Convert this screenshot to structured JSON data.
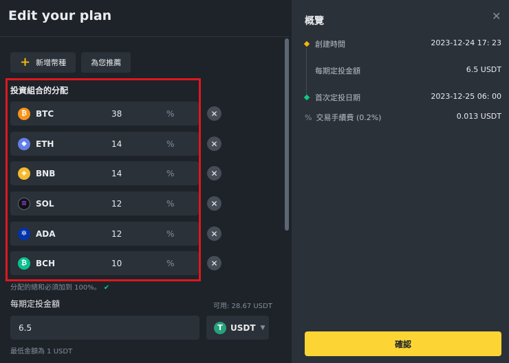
{
  "dialog": {
    "title": "Edit your plan"
  },
  "actions": {
    "add_coin_label": "新增幣種",
    "recommend_label": "為您推薦"
  },
  "allocation": {
    "label": "投資組合的分配",
    "percent_symbol": "%",
    "remove_symbol": "✕",
    "coins": [
      {
        "symbol": "BTC",
        "value": "38",
        "icon": "btc-icon",
        "color": "#f7931a",
        "glyph": "₿"
      },
      {
        "symbol": "ETH",
        "value": "14",
        "icon": "eth-icon",
        "color": "#627eea",
        "glyph": "◆"
      },
      {
        "symbol": "BNB",
        "value": "14",
        "icon": "bnb-icon",
        "color": "#f3ba2f",
        "glyph": "◈"
      },
      {
        "symbol": "SOL",
        "value": "12",
        "icon": "sol-icon",
        "color": "#111111",
        "glyph": "≡"
      },
      {
        "symbol": "ADA",
        "value": "12",
        "icon": "ada-icon",
        "color": "#0033ad",
        "glyph": "✲"
      },
      {
        "symbol": "BCH",
        "value": "10",
        "icon": "bch-icon",
        "color": "#0ac18e",
        "glyph": "₿"
      }
    ],
    "note": "分配的總和必須加到 100%。",
    "note_check": "✔"
  },
  "periodic": {
    "label": "每期定投金額",
    "available": "可用: 28.67 USDT",
    "amount": "6.5",
    "currency": "USDT",
    "currency_icon": "usdt-icon",
    "currency_glyph": "T",
    "caret": "▼",
    "min_note": "最低金額為 1 USDT"
  },
  "summary": {
    "title": "概覽",
    "close": "✕",
    "rows": [
      {
        "label": "創建時間",
        "value": "2023-12-24 17: 23"
      },
      {
        "label": "每期定投金額",
        "value": "6.5 USDT"
      },
      {
        "label": "首次定投日期",
        "value": "2023-12-25 06: 00"
      },
      {
        "label": "交易手續費 (0.2%)",
        "value": "0.013 USDT"
      }
    ],
    "fee_icon_glyph": "%"
  },
  "confirm_label": "確認",
  "colors": {
    "accent": "#fcd535",
    "highlight_border": "#e0171f",
    "success": "#0ecb81",
    "timeline_start": "#f0b90b"
  }
}
